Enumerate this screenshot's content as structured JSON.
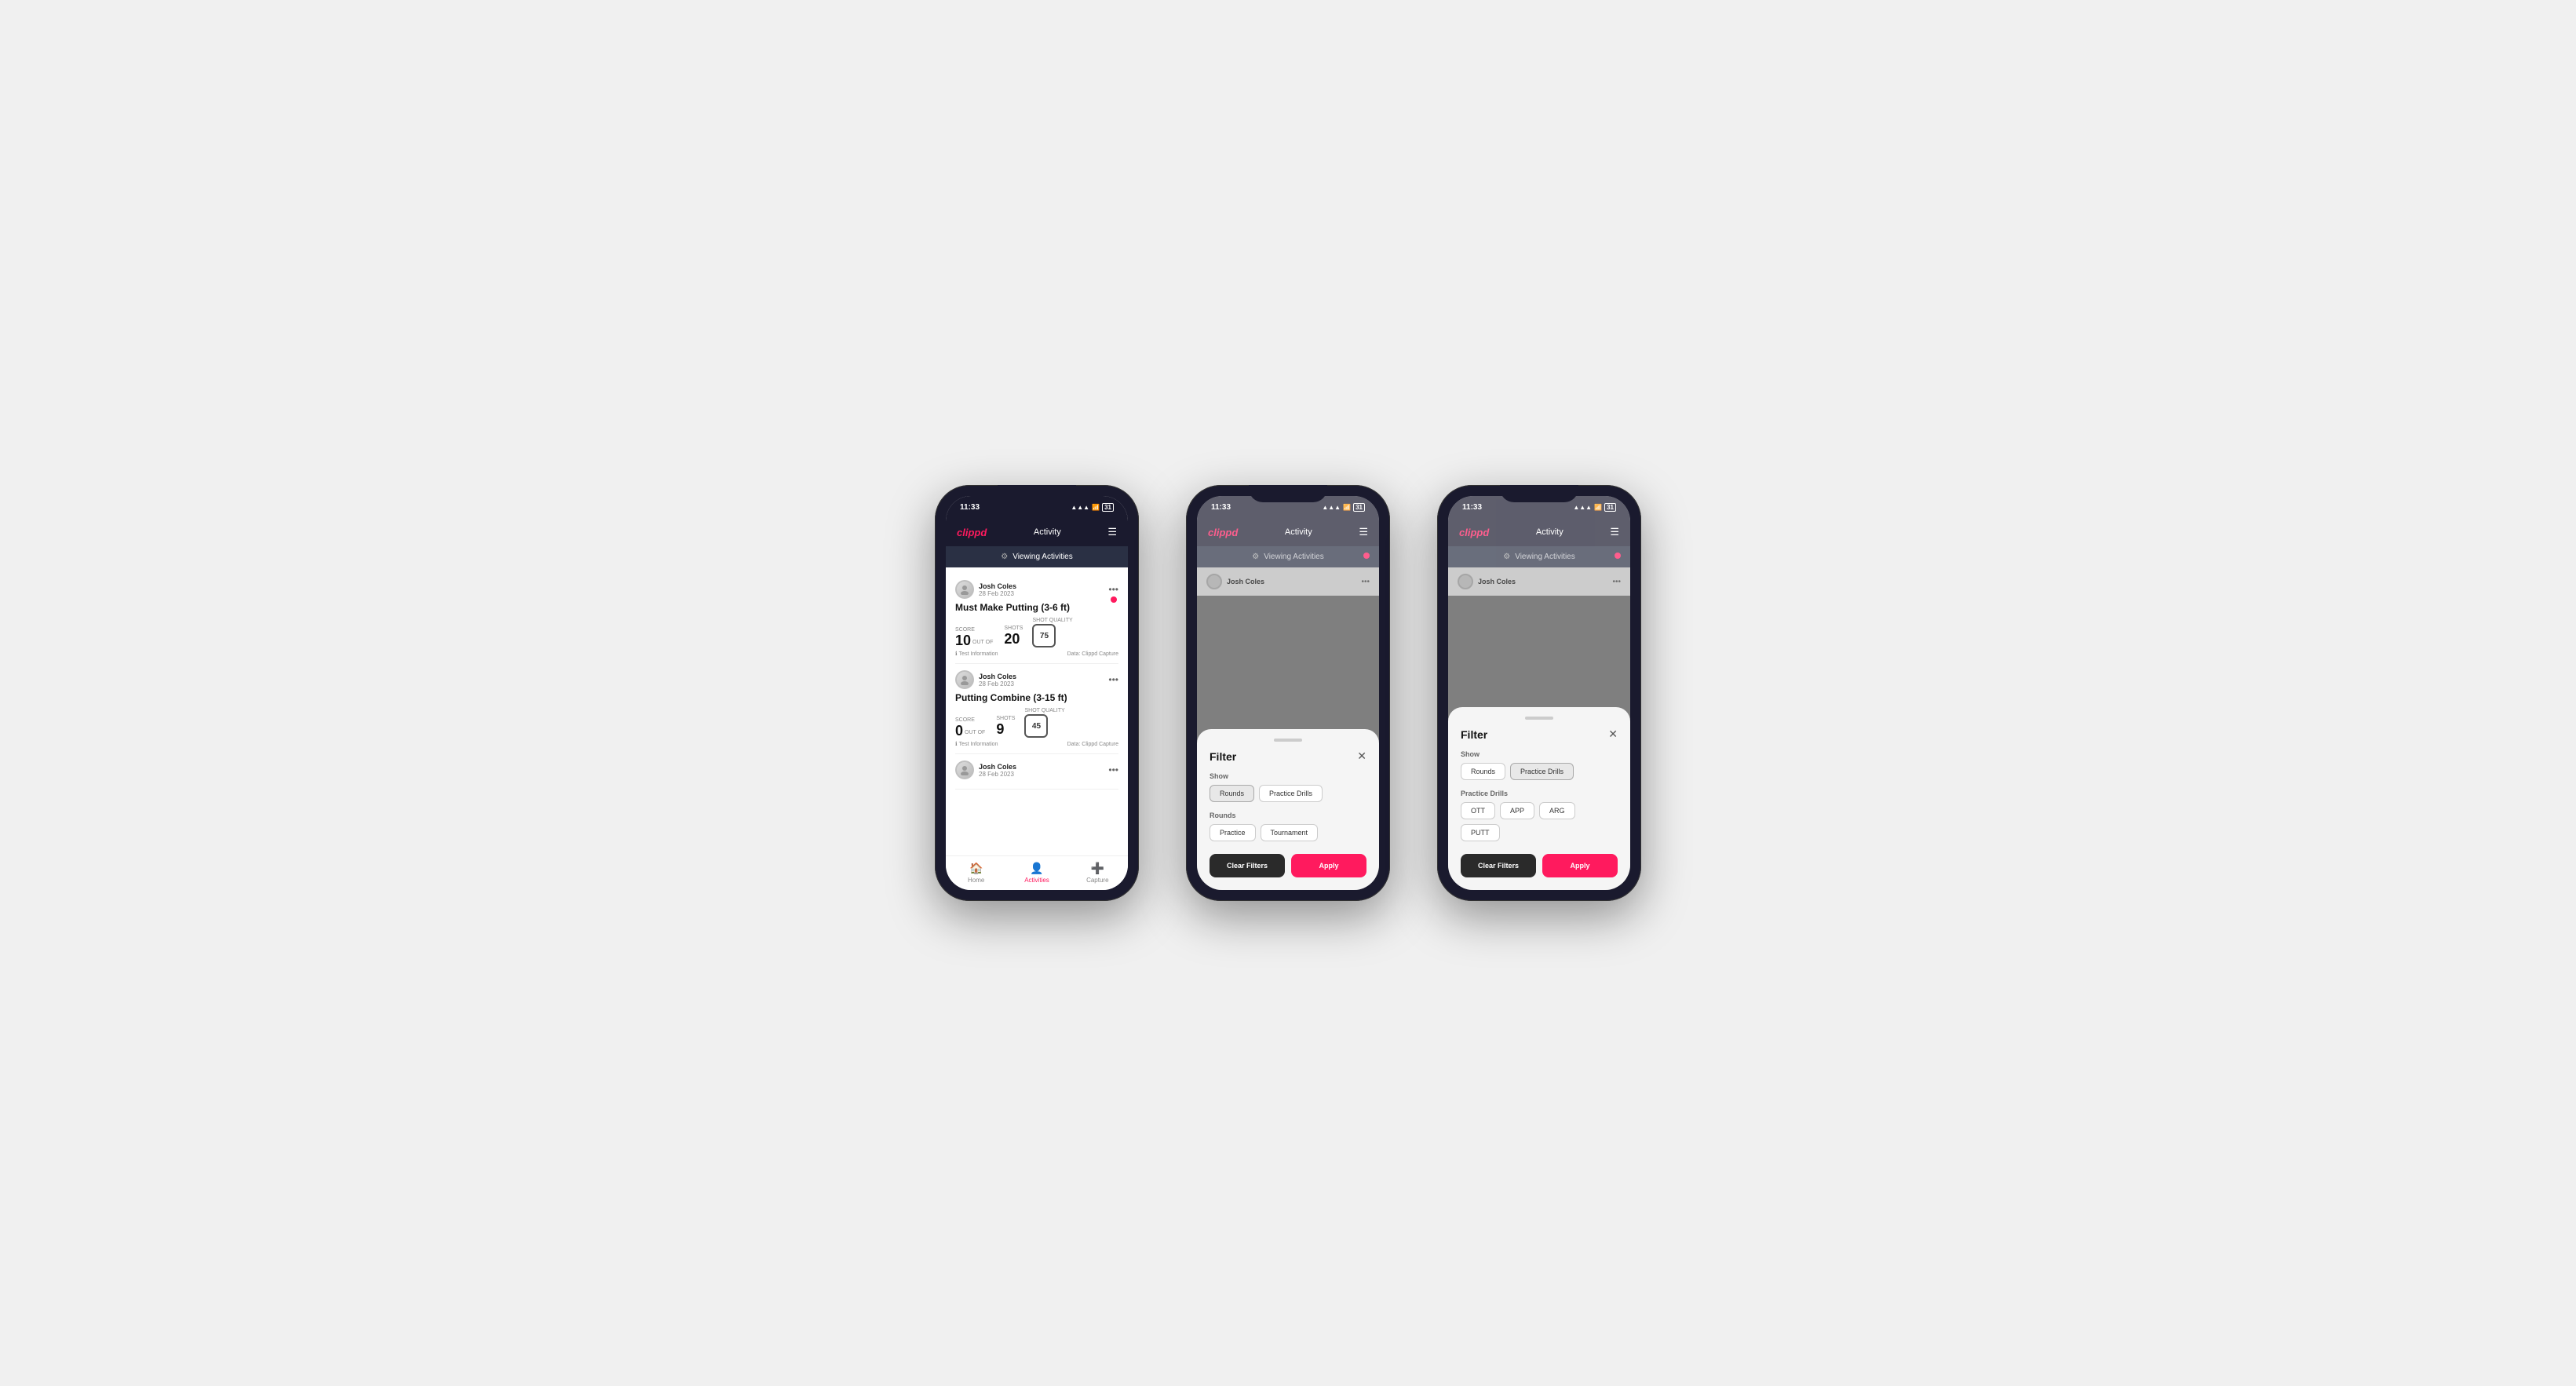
{
  "status": {
    "time": "11:33",
    "signal": "●●●",
    "wifi": "WiFi",
    "battery": "31"
  },
  "nav": {
    "logo": "clippd",
    "title": "Activity",
    "menu_icon": "☰"
  },
  "viewing_bar": {
    "icon": "⚙",
    "label": "Viewing Activities"
  },
  "phone1": {
    "cards": [
      {
        "user_name": "Josh Coles",
        "user_date": "28 Feb 2023",
        "title": "Must Make Putting (3-6 ft)",
        "score_label": "Score",
        "score_value": "10",
        "out_of": "OUT OF",
        "shots_label": "Shots",
        "shots_value": "20",
        "shot_quality_label": "Shot Quality",
        "shot_quality_value": "75",
        "info": "Test Information",
        "data": "Data: Clippd Capture"
      },
      {
        "user_name": "Josh Coles",
        "user_date": "28 Feb 2023",
        "title": "Putting Combine (3-15 ft)",
        "score_label": "Score",
        "score_value": "0",
        "out_of": "OUT OF",
        "shots_label": "Shots",
        "shots_value": "9",
        "shot_quality_label": "Shot Quality",
        "shot_quality_value": "45",
        "info": "Test Information",
        "data": "Data: Clippd Capture"
      },
      {
        "user_name": "Josh Coles",
        "user_date": "28 Feb 2023",
        "title": "",
        "score_label": "",
        "score_value": "",
        "out_of": "",
        "shots_label": "",
        "shots_value": "",
        "shot_quality_label": "",
        "shot_quality_value": "",
        "info": "",
        "data": ""
      }
    ],
    "tabs": [
      {
        "icon": "🏠",
        "label": "Home",
        "active": false
      },
      {
        "icon": "👤",
        "label": "Activities",
        "active": true
      },
      {
        "icon": "➕",
        "label": "Capture",
        "active": false
      }
    ]
  },
  "phone2": {
    "filter": {
      "title": "Filter",
      "show_label": "Show",
      "show_buttons": [
        {
          "label": "Rounds",
          "active": true
        },
        {
          "label": "Practice Drills",
          "active": false
        }
      ],
      "rounds_label": "Rounds",
      "rounds_buttons": [
        {
          "label": "Practice",
          "active": false
        },
        {
          "label": "Tournament",
          "active": false
        }
      ],
      "clear_label": "Clear Filters",
      "apply_label": "Apply"
    }
  },
  "phone3": {
    "filter": {
      "title": "Filter",
      "show_label": "Show",
      "show_buttons": [
        {
          "label": "Rounds",
          "active": false
        },
        {
          "label": "Practice Drills",
          "active": true
        }
      ],
      "drills_label": "Practice Drills",
      "drills_buttons": [
        {
          "label": "OTT",
          "active": false
        },
        {
          "label": "APP",
          "active": false
        },
        {
          "label": "ARG",
          "active": false
        },
        {
          "label": "PUTT",
          "active": false
        }
      ],
      "clear_label": "Clear Filters",
      "apply_label": "Apply"
    }
  }
}
